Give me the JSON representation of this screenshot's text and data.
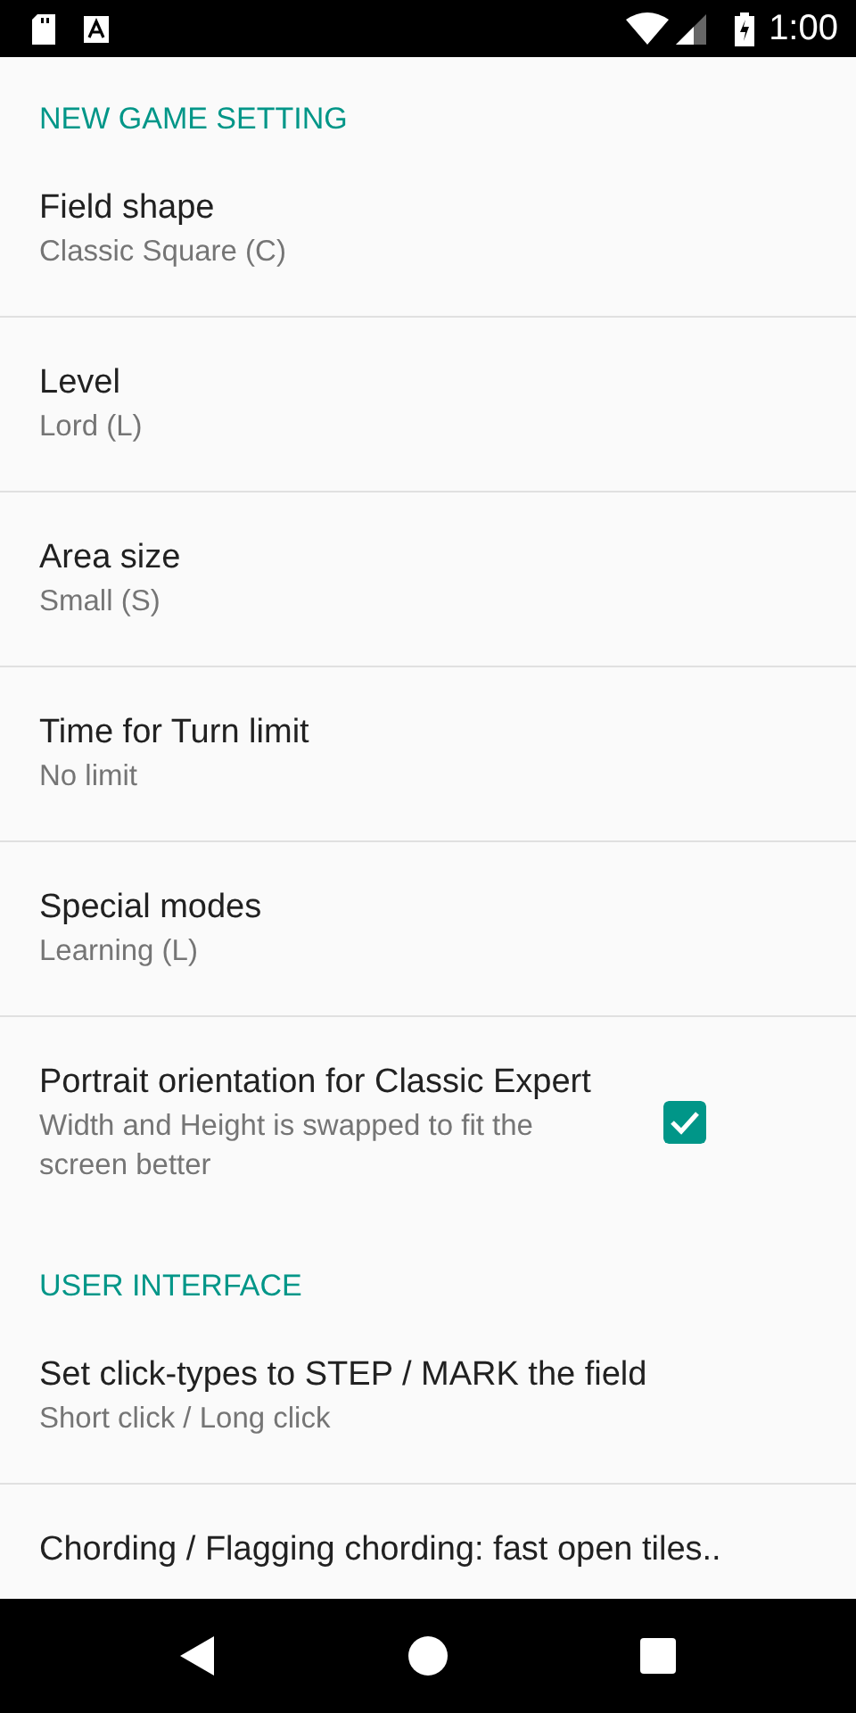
{
  "status_bar": {
    "time": "1:00"
  },
  "sections": [
    {
      "title": "NEW GAME SETTING",
      "items": [
        {
          "kind": "plain",
          "title": "Field shape",
          "summary": "Classic Square (C)"
        },
        {
          "kind": "plain",
          "title": "Level",
          "summary": "Lord (L)"
        },
        {
          "kind": "plain",
          "title": "Area size",
          "summary": "Small (S)"
        },
        {
          "kind": "plain",
          "title": "Time for Turn limit",
          "summary": "No limit"
        },
        {
          "kind": "plain",
          "title": "Special modes",
          "summary": "Learning (L)"
        },
        {
          "kind": "checkbox",
          "title": "Portrait orientation for Classic Expert",
          "summary": "Width and Height is swapped to fit the screen better",
          "checked": true
        }
      ]
    },
    {
      "title": "USER INTERFACE",
      "items": [
        {
          "kind": "plain",
          "title": "Set click-types to STEP / MARK the field",
          "summary": "Short click / Long click"
        },
        {
          "kind": "plain",
          "title": "Chording / Flagging chording: fast open tiles.."
        }
      ]
    }
  ]
}
